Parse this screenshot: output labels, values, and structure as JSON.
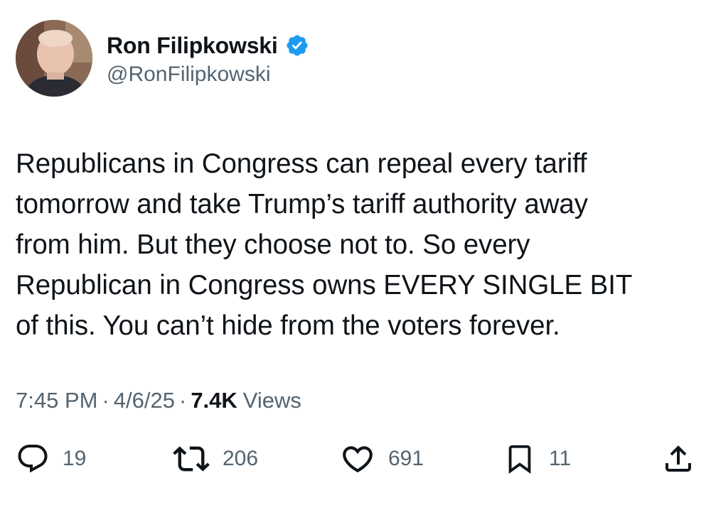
{
  "author": {
    "display_name": "Ron Filipkowski",
    "handle": "@RonFilipkowski",
    "verified": true,
    "avatar_icon": "profile-photo"
  },
  "tweet": {
    "text": "Republicans in Congress can repeal every tariff\ntomorrow and take Trump’s tariff authority away\nfrom him. But they choose not to. So every\nRepublican in Congress owns EVERY SINGLE BIT\nof this. You can’t hide from the voters forever."
  },
  "meta": {
    "time": "7:45 PM",
    "separator": "·",
    "date": "4/6/25",
    "views_count": "7.4K",
    "views_label": "Views"
  },
  "actions": {
    "reply": {
      "icon": "reply-icon",
      "count": "19"
    },
    "retweet": {
      "icon": "retweet-icon",
      "count": "206"
    },
    "like": {
      "icon": "heart-icon",
      "count": "691"
    },
    "bookmark": {
      "icon": "bookmark-icon",
      "count": "11"
    },
    "share": {
      "icon": "share-icon"
    }
  },
  "colors": {
    "text_primary": "#0f1419",
    "text_secondary": "#536471",
    "verified_blue": "#1d9bf0",
    "background": "#ffffff"
  }
}
